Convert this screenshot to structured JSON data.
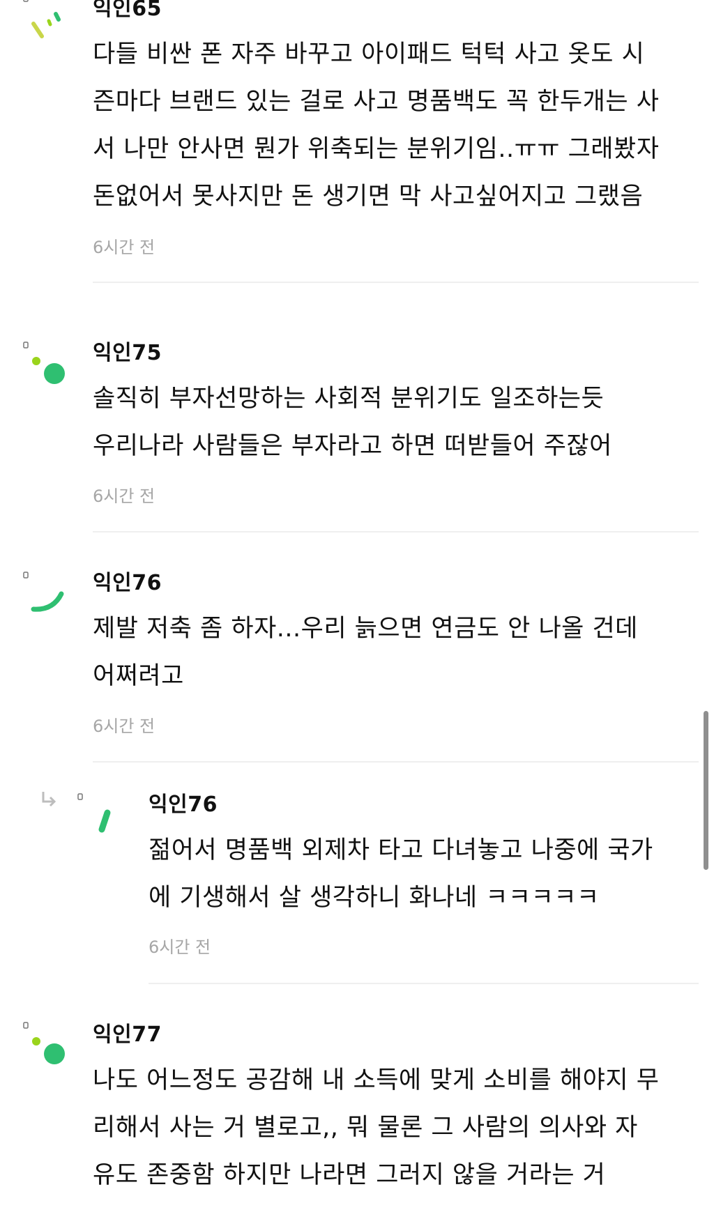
{
  "comments": [
    {
      "author": "익인65",
      "lines": [
        "다들 비싼 폰 자주 바꾸고 아이패드 턱턱 사고 옷도 시",
        "즌마다 브랜드 있는 걸로 사고 명품백도 꼭 한두개는 사",
        "서 나만 안사면 뭔가 위축되는 분위기임..ㅠㅠ 그래봤자",
        "돈없어서 못사지만 돈 생기면 막 사고싶어지고 그랬음"
      ],
      "time": "6시간 전",
      "avatar_icon": "confetti-avatar-icon"
    },
    {
      "author": "익인75",
      "lines": [
        "솔직히 부자선망하는 사회적 분위기도 일조하는듯",
        "우리나라 사람들은 부자라고 하면 떠받들어 주잖어"
      ],
      "time": "6시간 전",
      "avatar_icon": "dots-avatar-icon"
    },
    {
      "author": "익인76",
      "lines": [
        "제발 저축 좀 하자...우리 늙으면 연금도 안 나올 건데",
        "어쩌려고"
      ],
      "time": "6시간 전",
      "avatar_icon": "arc-avatar-icon"
    },
    {
      "author": "익인76",
      "lines": [
        "젊어서 명품백 외제차 타고 다녀놓고 나중에 국가",
        "에 기생해서 살 생각하니 화나네 ㅋㅋㅋㅋㅋ"
      ],
      "time": "6시간 전",
      "avatar_icon": "dash-avatar-icon",
      "is_reply": true
    },
    {
      "author": "익인77",
      "lines": [
        "나도 어느정도 공감해 내 소득에 맞게 소비를 해야지 무",
        "리해서 사는 거 별로고,, 뭐 물론 그 사람의 의사와 자",
        "유도 존중함 하지만 나라면 그러지 않을 거라는 거"
      ],
      "avatar_icon": "dots-avatar-icon"
    }
  ],
  "colors": {
    "green": "#2fbf71",
    "lime": "#9ad41c",
    "yellow_green": "#c9d64a",
    "time_gray": "#a6a6a6",
    "divider": "#efefef"
  }
}
